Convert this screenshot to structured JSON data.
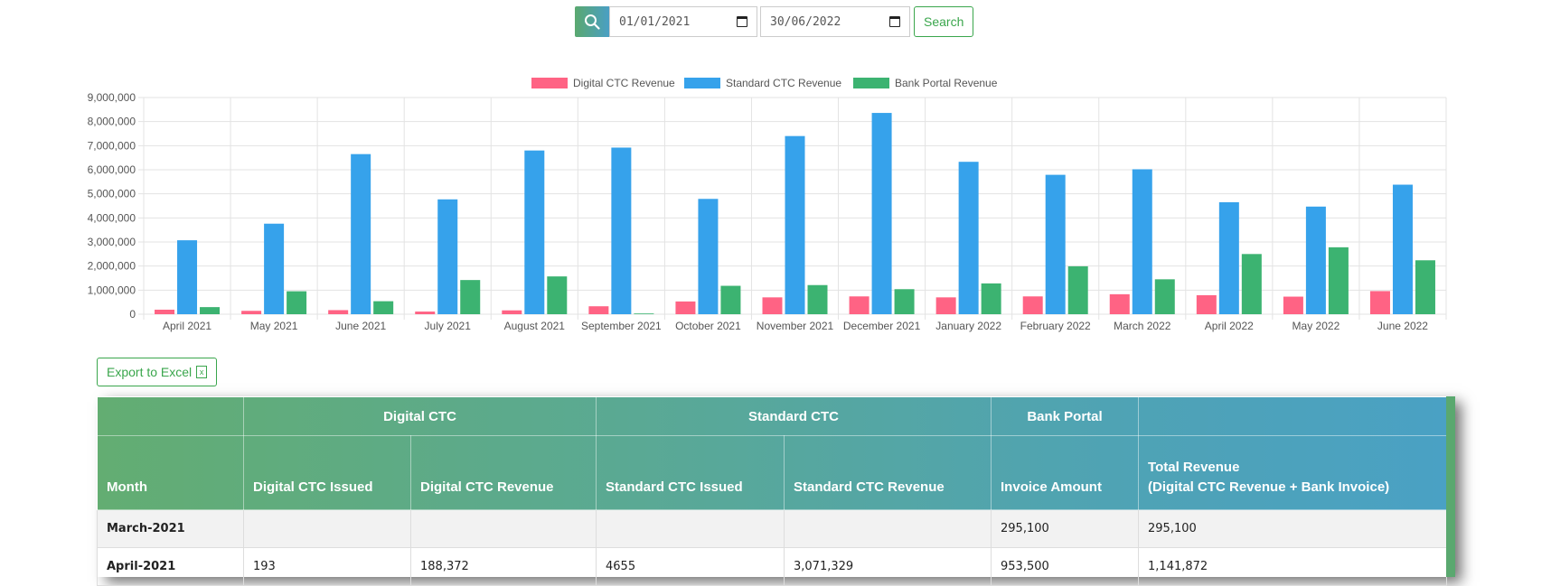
{
  "search": {
    "start_date": "01/01/2021",
    "end_date": "30/06/2022",
    "button_label": "Search"
  },
  "export": {
    "label": "Export to Excel"
  },
  "chart_data": {
    "type": "bar",
    "categories": [
      "April 2021",
      "May 2021",
      "June 2021",
      "July 2021",
      "August 2021",
      "September 2021",
      "October 2021",
      "November 2021",
      "December 2021",
      "January 2022",
      "February 2022",
      "March 2022",
      "April 2022",
      "May 2022",
      "June 2022"
    ],
    "series": [
      {
        "name": "Digital CTC Revenue",
        "color": "#ff6384",
        "values": [
          188372,
          140000,
          170000,
          110000,
          160000,
          330000,
          530000,
          700000,
          740000,
          700000,
          740000,
          830000,
          790000,
          730000,
          960000
        ]
      },
      {
        "name": "Standard CTC Revenue",
        "color": "#36a2eb",
        "values": [
          3071329,
          3760000,
          6650000,
          4770000,
          6800000,
          6920000,
          4790000,
          7400000,
          8360000,
          6330000,
          5790000,
          6020000,
          4650000,
          4470000,
          5380000
        ]
      },
      {
        "name": "Bank Portal Revenue",
        "color": "#3cb371",
        "values": [
          295100,
          953500,
          540000,
          1420000,
          1570000,
          30000,
          1180000,
          1210000,
          1040000,
          1280000,
          1990000,
          1450000,
          2500000,
          2780000,
          2240000
        ]
      }
    ],
    "ylim": [
      0,
      9000000
    ],
    "yticks": [
      "0",
      "1,000,000",
      "2,000,000",
      "3,000,000",
      "4,000,000",
      "5,000,000",
      "6,000,000",
      "7,000,000",
      "8,000,000",
      "9,000,000"
    ],
    "legend_position": "top-center",
    "grid": true
  },
  "table": {
    "group_headers": [
      "Digital CTC",
      "Standard CTC",
      "Bank Portal"
    ],
    "headers": [
      "Month",
      "Digital CTC Issued",
      "Digital CTC Revenue",
      "Standard CTC Issued",
      "Standard CTC Revenue",
      "Invoice Amount",
      "Total Revenue",
      "(Digital CTC Revenue + Bank Invoice)"
    ],
    "rows": [
      [
        "March-2021",
        "",
        "",
        "",
        "",
        "295,100",
        "295,100"
      ],
      [
        "April-2021",
        "193",
        "188,372",
        "4655",
        "3,071,329",
        "953,500",
        "1,141,872"
      ]
    ]
  }
}
